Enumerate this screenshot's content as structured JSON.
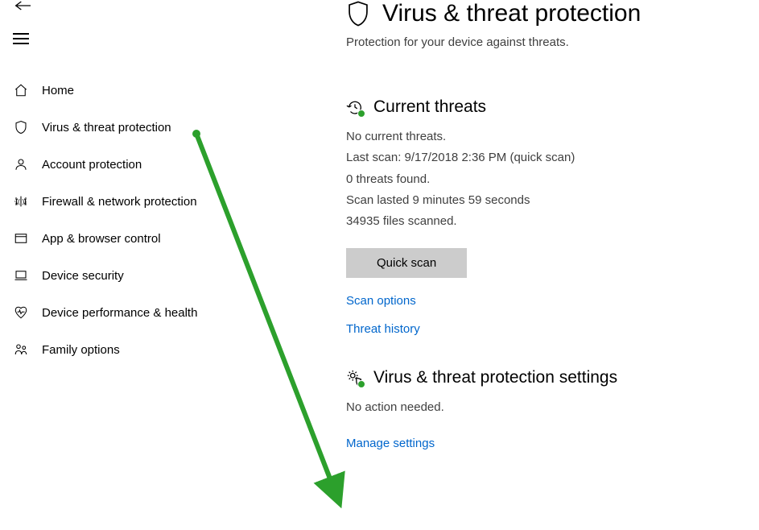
{
  "sidebar": {
    "items": [
      {
        "label": "Home",
        "icon": "home-icon"
      },
      {
        "label": "Virus & threat protection",
        "icon": "shield-icon"
      },
      {
        "label": "Account protection",
        "icon": "person-icon"
      },
      {
        "label": "Firewall & network protection",
        "icon": "signal-icon"
      },
      {
        "label": "App & browser control",
        "icon": "window-icon"
      },
      {
        "label": "Device security",
        "icon": "laptop-icon"
      },
      {
        "label": "Device performance & health",
        "icon": "heart-icon"
      },
      {
        "label": "Family options",
        "icon": "family-icon"
      }
    ]
  },
  "header": {
    "title": "Virus & threat protection",
    "subtitle": "Protection for your device against threats."
  },
  "threats": {
    "section_title": "Current threats",
    "status": "No current threats.",
    "last_scan": "Last scan: 9/17/2018 2:36 PM (quick scan)",
    "threats_found": "0 threats found.",
    "scan_duration": "Scan lasted 9 minutes 59 seconds",
    "files_scanned": "34935 files scanned.",
    "quick_scan_btn": "Quick scan",
    "scan_options_link": "Scan options",
    "threat_history_link": "Threat history"
  },
  "settings": {
    "section_title": "Virus & threat protection settings",
    "status": "No action needed.",
    "manage_link": "Manage settings"
  },
  "annotation": {
    "type": "arrow",
    "color": "#2ca02c",
    "from": "sidebar virus & threat protection item",
    "to": "manage settings link"
  }
}
